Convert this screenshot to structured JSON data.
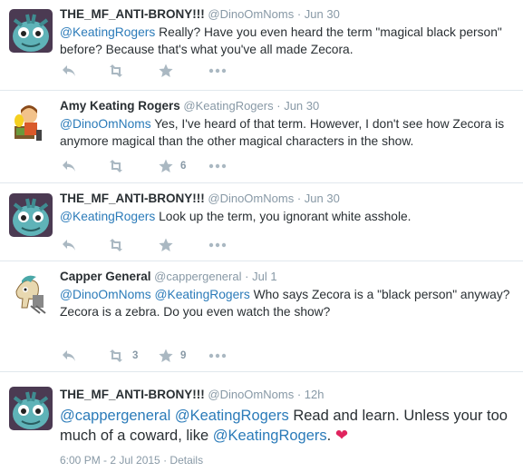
{
  "tweets": [
    {
      "name": "THE_MF_ANTI-BRONY!!!",
      "handle": "@DinoOmNoms",
      "sep": "·",
      "time": "Jun 30",
      "mention": "@KeatingRogers",
      "text": " Really? Have you even heard the term \"magical black person\" before? Because that's what you've all made Zecora."
    },
    {
      "name": "Amy Keating Rogers",
      "handle": "@KeatingRogers",
      "sep": "·",
      "time": "Jun 30",
      "mention": "@DinoOmNoms",
      "text": " Yes, I've heard of that term. However, I don't see how Zecora is anymore magical than the other magical characters in the show.",
      "favorites": "6"
    },
    {
      "name": "THE_MF_ANTI-BRONY!!!",
      "handle": "@DinoOmNoms",
      "sep": "·",
      "time": "Jun 30",
      "mention": "@KeatingRogers",
      "text": " Look up the term, you ignorant white asshole."
    },
    {
      "name": "Capper General",
      "handle": "@cappergeneral",
      "sep": "·",
      "time": "Jul 1",
      "mention1": "@DinoOmNoms",
      "mention2": "@KeatingRogers",
      "text1": " Who says Zecora is a \"black person\" anyway?",
      "text2": "Zecora is a zebra. Do you even watch the show?",
      "retweets": "3",
      "favorites": "9"
    },
    {
      "name": "THE_MF_ANTI-BRONY!!!",
      "handle": "@DinoOmNoms",
      "sep": "·",
      "time": "12h",
      "mention1": "@cappergeneral",
      "mention2": "@KeatingRogers",
      "text1": " Read and learn. Unless your too much of a coward, like ",
      "mention3": "@KeatingRogers",
      "text2": ". ",
      "heart": "❤",
      "footer_time": "6:00 PM - 2 Jul 2015",
      "footer_sep": "·",
      "footer_link": "Details"
    }
  ],
  "icons": [
    "reply-icon",
    "retweet-icon",
    "favorite-icon",
    "more-icon",
    "heart-emoji"
  ],
  "colors": {
    "link": "#2b7bb9",
    "muted": "#8899a6",
    "icon": "#aab8c2",
    "heart": "#e0245e"
  }
}
